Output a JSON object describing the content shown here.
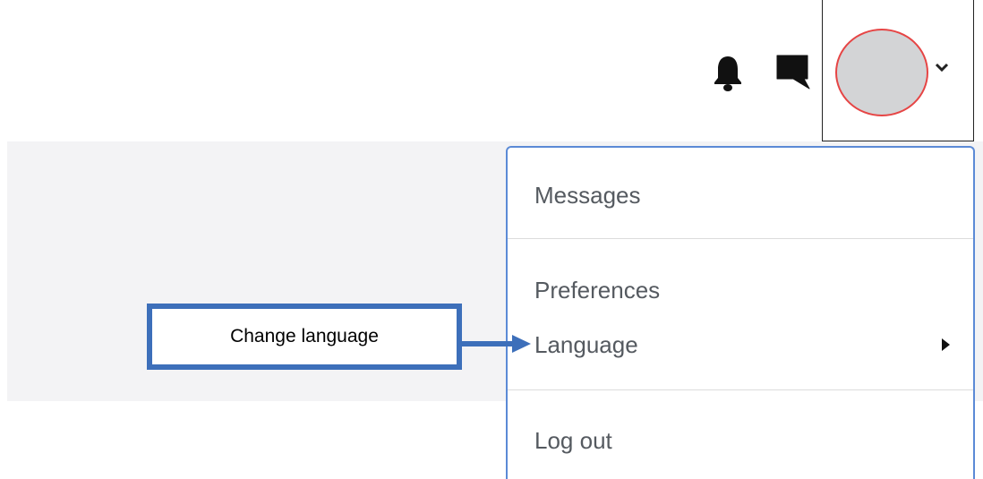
{
  "navbar": {
    "icons": {
      "notifications": "bell-icon",
      "messages": "chat-bubble-icon"
    },
    "user_menu": {
      "toggle_icon": "chevron-down-icon"
    }
  },
  "dropdown": {
    "items": [
      {
        "label": "Messages"
      },
      {
        "label": "Preferences"
      },
      {
        "label": "Language",
        "submenu_icon": "caret-right-icon"
      },
      {
        "label": "Log out"
      }
    ]
  },
  "annotation": {
    "label": "Change language"
  },
  "colors": {
    "dropdown_border": "#5b8ad6",
    "avatar_border": "#e64545",
    "avatar_fill": "#d3d4d6",
    "callout": "#3d6fba",
    "content_band": "#f3f3f5"
  }
}
